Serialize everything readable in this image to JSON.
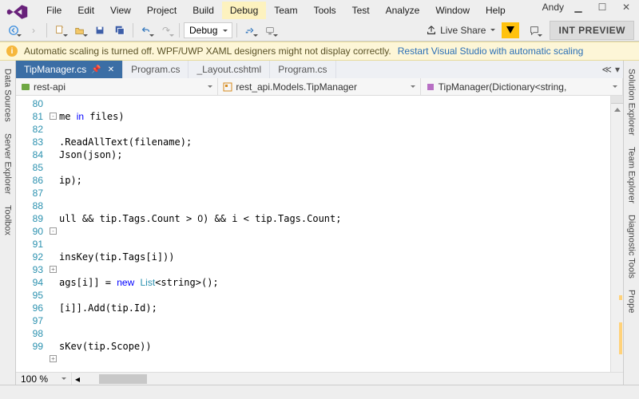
{
  "menu": [
    "File",
    "Edit",
    "View",
    "Project",
    "Build",
    "Debug",
    "Team",
    "Tools",
    "Test",
    "Analyze",
    "Window",
    "Help"
  ],
  "menu_selected_index": 5,
  "user": "Andy",
  "config": "Debug",
  "live_share": "Live Share",
  "preview": "INT PREVIEW",
  "infobar": {
    "text": "Automatic scaling is turned off. WPF/UWP XAML designers might not display correctly.",
    "link": "Restart Visual Studio with automatic scaling"
  },
  "left_rail": [
    "Data Sources",
    "Server Explorer",
    "Toolbox"
  ],
  "right_rail": [
    "Solution Explorer",
    "Team Explorer",
    "Diagnostic Tools",
    "Prope"
  ],
  "tabs": [
    {
      "label": "TipManager.cs",
      "active": true,
      "pinned": true
    },
    {
      "label": "Program.cs",
      "active": false
    },
    {
      "label": "_Layout.cshtml",
      "active": false
    },
    {
      "label": "Program.cs",
      "active": false
    }
  ],
  "nav": {
    "project": "rest-api",
    "class": "rest_api.Models.TipManager",
    "member": "TipManager(Dictionary<string,"
  },
  "zoom": "100 %",
  "status": "",
  "code": {
    "start": 80,
    "lines": [
      "",
      "me in files)",
      "",
      ".ReadAllText(filename);",
      "Json(json);",
      "",
      "ip);",
      "",
      "",
      "ull && tip.Tags.Count > 0) && i < tip.Tags.Count;",
      "",
      "",
      "insKey(tip.Tags[i]))",
      "",
      "ags[i]] = new List<string>();",
      "",
      "[i]].Add(tip.Id);",
      "",
      "",
      "sKev(tip.Scope))"
    ]
  }
}
